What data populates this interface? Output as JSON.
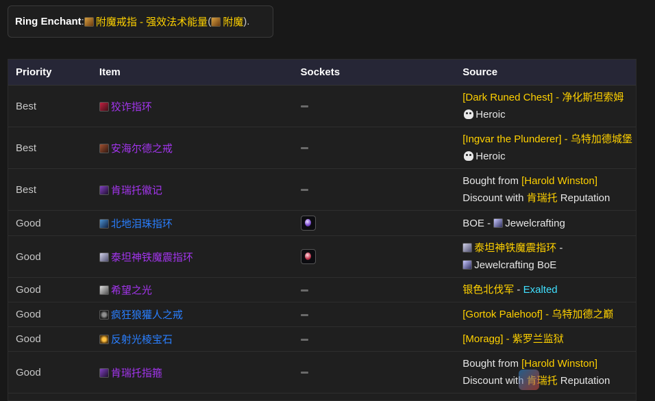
{
  "enchant": {
    "label": "Ring Enchant",
    "colon": ": ",
    "name": "附魔戒指 - 强效法术能量",
    "paren_open": " (",
    "profession": "附魔",
    "paren_close": ")."
  },
  "table": {
    "headers": [
      "Priority",
      "Item",
      "Sockets",
      "Source"
    ],
    "rows": [
      {
        "priority": "Best",
        "item": "狡诈指环",
        "item_color": "#a335ee",
        "socket": "none",
        "src_a": "[Dark Runed Chest]",
        "src_b": " - ",
        "src_c": "净化斯坦索姆",
        "src_d": "Heroic"
      },
      {
        "priority": "Best",
        "item": "安海尔德之戒",
        "item_color": "#a335ee",
        "socket": "none",
        "src_a": "[Ingvar the Plunderer]",
        "src_b": " - ",
        "src_c": "乌特加德城堡",
        "src_d": "Heroic"
      },
      {
        "priority": "Best",
        "item": "肯瑞托徽记",
        "item_color": "#a335ee",
        "socket": "none",
        "src_a": "Bought from ",
        "src_b": "[Harold Winston]",
        "src_c": "Discount with ",
        "src_d": "肯瑞托",
        "src_e": " Reputation"
      },
      {
        "priority": "Good",
        "item": "北地泪珠指环",
        "item_color": "#2a7fff",
        "socket": "purple",
        "src_a": "BOE - ",
        "src_b": "Jewelcrafting"
      },
      {
        "priority": "Good",
        "item": "泰坦神铁魔震指环",
        "item_color": "#a335ee",
        "socket": "red",
        "src_a": "泰坦神铁魔震指环",
        "src_b": " - ",
        "src_c": "Jewelcrafting BoE"
      },
      {
        "priority": "Good",
        "item": "希望之光",
        "item_color": "#a335ee",
        "socket": "none",
        "src_a": "银色北伐军",
        "src_b": " - ",
        "src_c": "Exalted"
      },
      {
        "priority": "Good",
        "item": "疯狂狼獾人之戒",
        "item_color": "#2a7fff",
        "socket": "none",
        "src_a": "[Gortok Palehoof]",
        "src_b": " - ",
        "src_c": "乌特加德之巅"
      },
      {
        "priority": "Good",
        "item": "反射光棱宝石",
        "item_color": "#2a7fff",
        "socket": "none",
        "src_a": "[Moragg]",
        "src_b": " - ",
        "src_c": "紫罗兰监狱"
      },
      {
        "priority": "Good",
        "item": "肯瑞托指箍",
        "item_color": "#a335ee",
        "socket": "none",
        "src_a": "Bought from ",
        "src_b": "[Harold Winston]",
        "src_c": "Discount with ",
        "src_d": "肯瑞托",
        "src_e": " Reputation"
      }
    ]
  },
  "colors": {
    "gold": "#ffd100",
    "epic": "#a335ee",
    "rare": "#2a7fff",
    "exalted": "#40e0ff"
  },
  "icons": [
    "scroll-icon",
    "ring-icon",
    "gem-socket-icon",
    "skull-icon"
  ]
}
